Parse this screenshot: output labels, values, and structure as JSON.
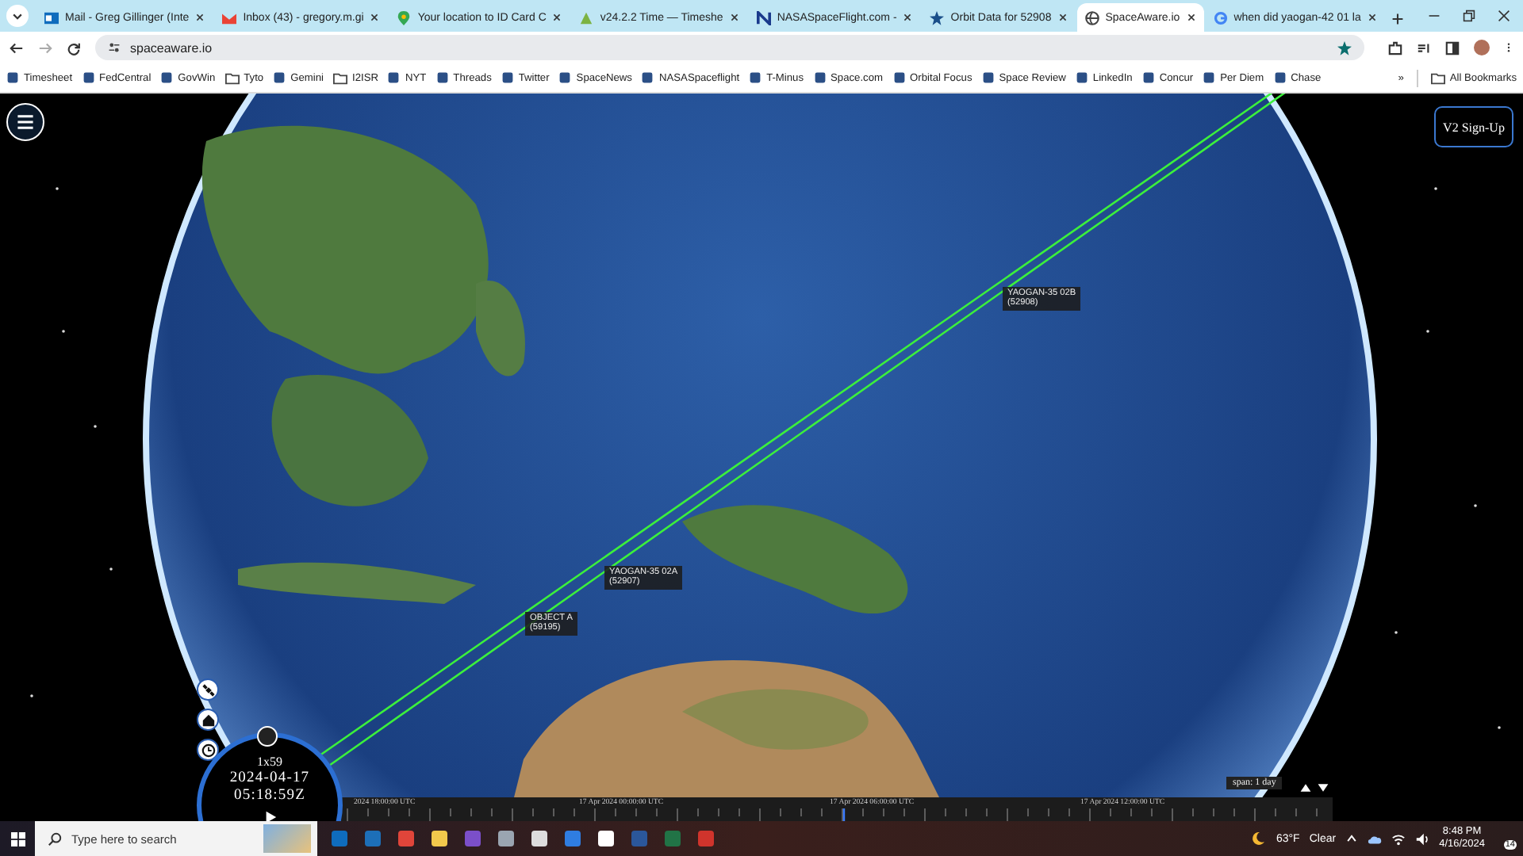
{
  "browser": {
    "tabs": [
      {
        "title": "Mail - Greg Gillinger (Inte",
        "kind": "mail",
        "selected": false
      },
      {
        "title": "Inbox (43) - gregory.m.gi",
        "kind": "gmail",
        "selected": false
      },
      {
        "title": "Your location to ID Card C",
        "kind": "maps",
        "selected": false
      },
      {
        "title": "v24.2.2 Time — Timeshe",
        "kind": "timesheet",
        "selected": false
      },
      {
        "title": "NASASpaceFlight.com -",
        "kind": "nsf",
        "selected": false
      },
      {
        "title": "Orbit Data for 52908",
        "kind": "star",
        "selected": false
      },
      {
        "title": "SpaceAware.io",
        "kind": "globe",
        "selected": true
      },
      {
        "title": "when did yaogan-42 01 la",
        "kind": "google",
        "selected": false
      }
    ],
    "address": "spaceaware.io",
    "bookmarks": [
      {
        "label": "Timesheet",
        "kind": "site"
      },
      {
        "label": "FedCentral",
        "kind": "site"
      },
      {
        "label": "GovWin",
        "kind": "site"
      },
      {
        "label": "Tyto",
        "kind": "folder"
      },
      {
        "label": "Gemini",
        "kind": "site"
      },
      {
        "label": "I2ISR",
        "kind": "folder"
      },
      {
        "label": "NYT",
        "kind": "site"
      },
      {
        "label": "Threads",
        "kind": "site"
      },
      {
        "label": "Twitter",
        "kind": "site"
      },
      {
        "label": "SpaceNews",
        "kind": "site"
      },
      {
        "label": "NASASpaceflight",
        "kind": "site"
      },
      {
        "label": "T-Minus",
        "kind": "site"
      },
      {
        "label": "Space.com",
        "kind": "site"
      },
      {
        "label": "Orbital Focus",
        "kind": "site"
      },
      {
        "label": "Space Review",
        "kind": "site"
      },
      {
        "label": "LinkedIn",
        "kind": "site"
      },
      {
        "label": "Concur",
        "kind": "site"
      },
      {
        "label": "Per Diem",
        "kind": "site"
      },
      {
        "label": "Chase",
        "kind": "site"
      }
    ],
    "overflow": "»",
    "all_bookmarks": "All Bookmarks"
  },
  "app": {
    "signup_button": "V2 Sign-Up",
    "objects": [
      {
        "name": "YAOGAN-35 02B",
        "number": "(52908)"
      },
      {
        "name": "YAOGAN-35 02A",
        "number": "(52907)"
      },
      {
        "name": "OBJECT A",
        "number": "(59195)"
      }
    ],
    "clock": {
      "speed": "1x59",
      "date": "2024-04-17",
      "time": "05:18:59Z"
    },
    "timeline": {
      "labels": [
        "2024 18:00:00 UTC",
        "17 Apr 2024 00:00:00 UTC",
        "17 Apr 2024 06:00:00 UTC",
        "17 Apr 2024 12:00:00 UTC"
      ],
      "span": "span: 1 day"
    }
  },
  "taskbar": {
    "search_placeholder": "Type here to search",
    "temperature": "63°F",
    "weather": "Clear",
    "time": "8:48 PM",
    "date": "4/16/2024",
    "notifications": "14"
  }
}
